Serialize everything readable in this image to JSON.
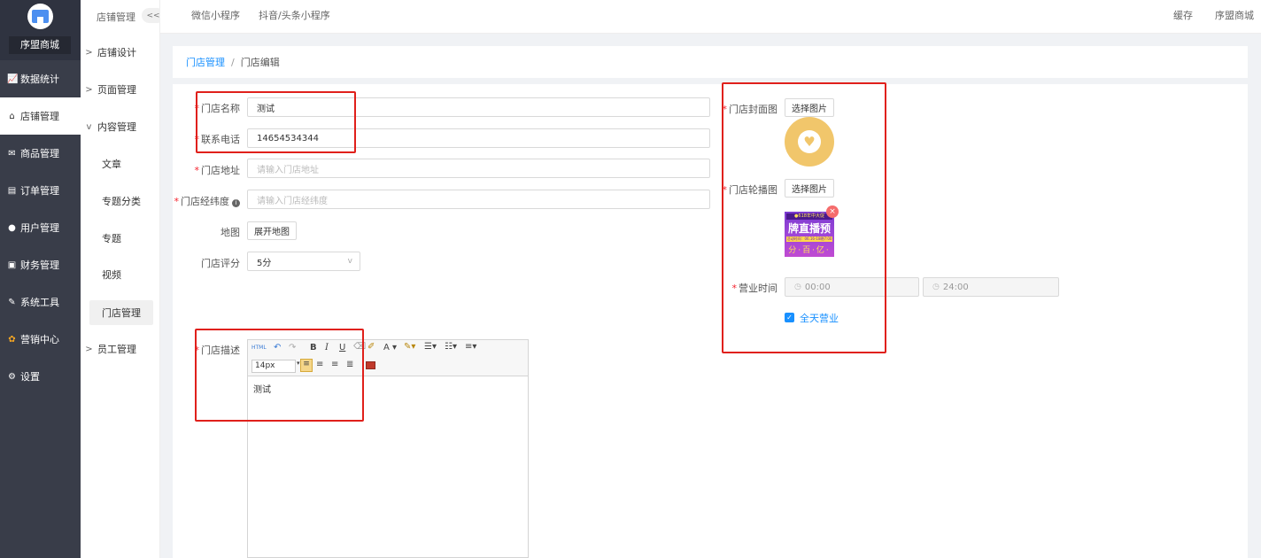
{
  "sidebar": {
    "brand": "序盟商城",
    "items": [
      {
        "icon": "📈",
        "label": "数据统计"
      },
      {
        "icon": "⌂",
        "label": "店铺管理"
      },
      {
        "icon": "✉",
        "label": "商品管理"
      },
      {
        "icon": "▤",
        "label": "订单管理"
      },
      {
        "icon": "●",
        "label": "用户管理"
      },
      {
        "icon": "▣",
        "label": "财务管理"
      },
      {
        "icon": "✎",
        "label": "系统工具"
      },
      {
        "icon": "✿",
        "label": "营销中心"
      },
      {
        "icon": "⚙",
        "label": "设置"
      }
    ]
  },
  "subnav": {
    "header": "店铺管理",
    "collapse": "<<",
    "groups": [
      "店铺设计",
      "页面管理",
      "内容管理"
    ],
    "children": [
      "文章",
      "专题分类",
      "专题",
      "视频",
      "门店管理"
    ],
    "last_group": "员工管理"
  },
  "topbar": {
    "tabs": [
      "微信小程序",
      "抖音/头条小程序"
    ],
    "cache": "缓存",
    "user": "序盟商城"
  },
  "breadcrumb": {
    "parent": "门店管理",
    "sep": "/",
    "current": "门店编辑"
  },
  "form": {
    "name_label": "门店名称",
    "name_value": "测试",
    "phone_label": "联系电话",
    "phone_value": "14654534344",
    "address_label": "门店地址",
    "address_placeholder": "请输入门店地址",
    "coords_label": "门店经纬度",
    "coords_placeholder": "请输入门店经纬度",
    "map_label": "地图",
    "map_button": "展开地图",
    "rating_label": "门店评分",
    "rating_value": "5分",
    "desc_label": "门店描述",
    "desc_content": "测试",
    "editor_font_size": "14px",
    "cover_label": "门店封面图",
    "cover_button": "选择图片",
    "carousel_label": "门店轮播图",
    "carousel_button": "选择图片",
    "banner_line1": "●618年中大促",
    "banner_line2": "牌直播预",
    "banner_line3": "活动时间：06.16-18晚7:00",
    "banner_line4": "分·百·亿·券",
    "hours_label": "营业时间",
    "hours_start": "00:00",
    "hours_end": "24:00",
    "allday_label": "全天营业"
  },
  "colors": {
    "accent": "#1890ff",
    "sidebar": "#393d49",
    "annotation": "#e0201b"
  }
}
